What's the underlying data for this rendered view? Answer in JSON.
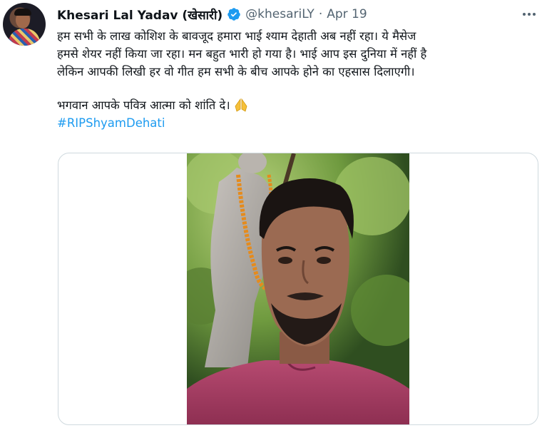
{
  "tweet": {
    "author_name": "Khesari Lal Yadav (खेसारी)",
    "handle": "@khesariLY",
    "separator": "·",
    "date": "Apr 19",
    "lines": [
      "हम सभी के लाख कोशिश के बावजूद हमारा भाई श्याम देहाती अब नहीं रहा। ये मैसेज",
      "हमसे शेयर नहीं किया जा रहा। मन बहुत भारी हो गया है। भाई आप इस दुनिया में नहीं है",
      "लेकिन आपकी लिखी हर वो गीत हम सभी के बीच आपके होने का एहसास दिलाएगी।"
    ],
    "closing_line": "भगवान आपके पवित्र आत्मा को शांति दे।",
    "hashtag": "#RIPShyamDehati"
  },
  "icons": {
    "verified": "verified-badge-icon",
    "more": "more-options-icon",
    "emoji": "folded-hands-emoji"
  },
  "colors": {
    "accent": "#1d9bf0",
    "secondary_text": "#536471",
    "border": "#cfd9de"
  }
}
